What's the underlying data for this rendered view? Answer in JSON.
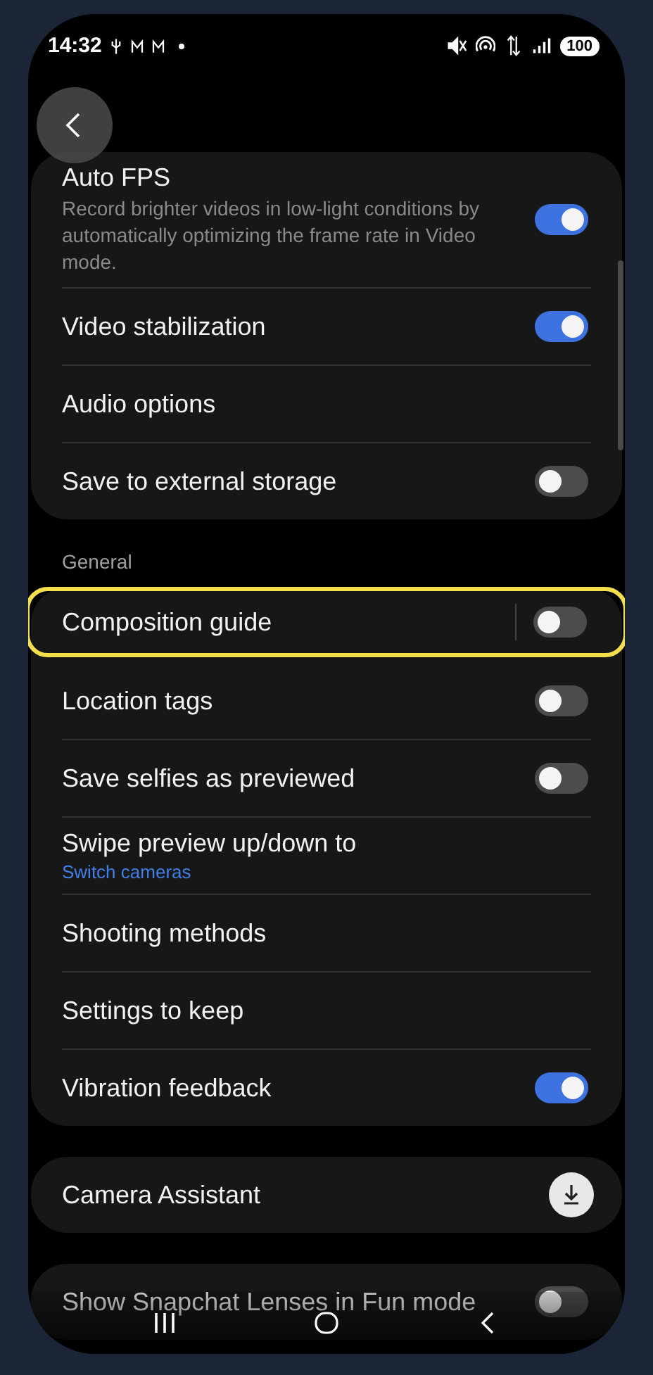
{
  "status_bar": {
    "time": "14:32",
    "battery": "100"
  },
  "groups": [
    {
      "rows": [
        {
          "kind": "toggle",
          "title": "Auto FPS",
          "description": "Record brighter videos in low-light conditions by automatically optimizing the frame rate in Video mode.",
          "on": true
        },
        {
          "kind": "toggle",
          "title": "Video stabilization",
          "on": true
        },
        {
          "kind": "link",
          "title": "Audio options"
        },
        {
          "kind": "toggle",
          "title": "Save to external storage",
          "on": false
        }
      ]
    },
    {
      "header": "General",
      "rows": [
        {
          "kind": "toggle",
          "title": "Composition guide",
          "on": false,
          "highlighted": true
        },
        {
          "kind": "toggle",
          "title": "Location tags",
          "on": false
        },
        {
          "kind": "toggle",
          "title": "Save selfies as previewed",
          "on": false
        },
        {
          "kind": "link",
          "title": "Swipe preview up/down to",
          "value": "Switch cameras"
        },
        {
          "kind": "link",
          "title": "Shooting methods"
        },
        {
          "kind": "link",
          "title": "Settings to keep"
        },
        {
          "kind": "toggle",
          "title": "Vibration feedback",
          "on": true
        }
      ]
    },
    {
      "rows": [
        {
          "kind": "download",
          "title": "Camera Assistant"
        }
      ]
    },
    {
      "rows": [
        {
          "kind": "toggle",
          "title": "Show Snapchat Lenses in Fun mode",
          "on": false
        }
      ]
    }
  ]
}
